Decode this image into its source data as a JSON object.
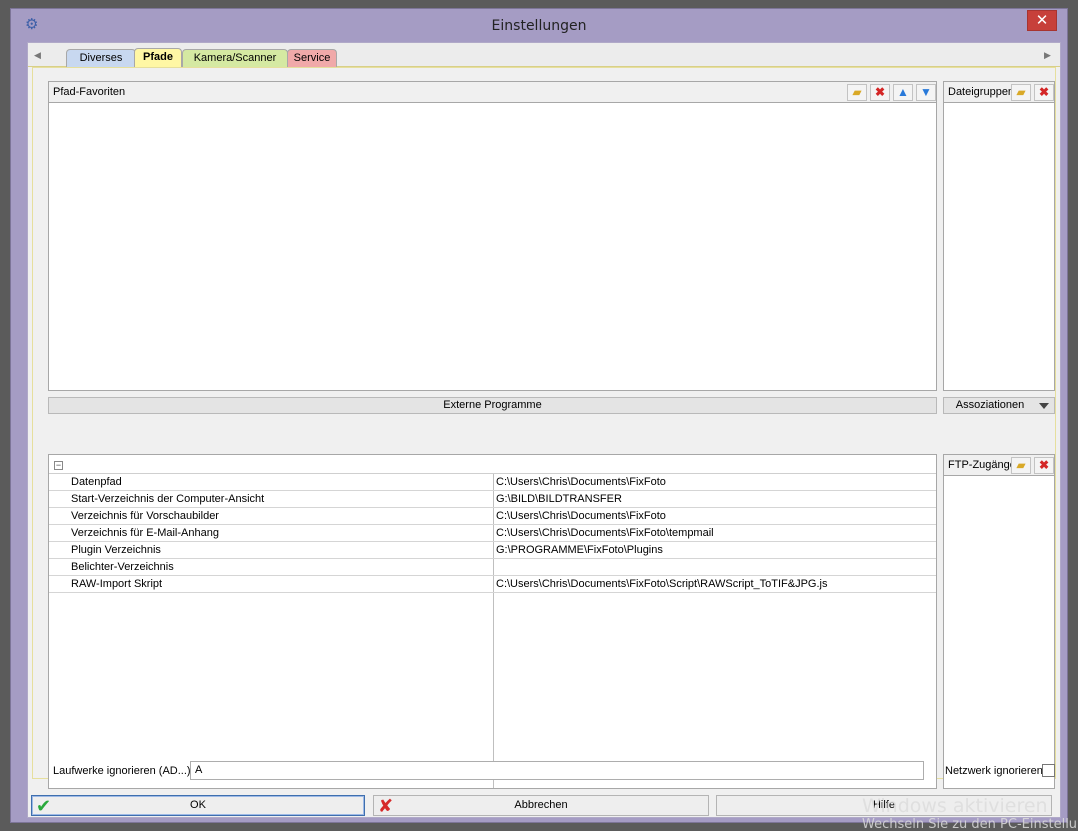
{
  "window": {
    "title": "Einstellungen",
    "close_label": "✕",
    "app_icon": "gear-icon"
  },
  "tabs": [
    {
      "label": "Diverses",
      "active": false
    },
    {
      "label": "Pfade",
      "active": true
    },
    {
      "label": "Kamera/Scanner",
      "active": false
    },
    {
      "label": "Service",
      "active": false
    }
  ],
  "favorites": {
    "title": "Pfad-Favoriten",
    "buttons": [
      "new-folder-icon",
      "delete-icon",
      "move-up-icon",
      "move-down-icon"
    ]
  },
  "file_groups": {
    "title": "Dateigruppen",
    "buttons": [
      "new-folder-icon",
      "delete-icon"
    ]
  },
  "external_programs": {
    "label": "Externe Programme"
  },
  "associations": {
    "label": "Assoziationen"
  },
  "paths": {
    "rows": [
      {
        "name": "Datenpfad",
        "value": "C:\\Users\\Chris\\Documents\\FixFoto"
      },
      {
        "name": "Start-Verzeichnis der Computer-Ansicht",
        "value": "G:\\BILD\\BILDTRANSFER"
      },
      {
        "name": "Verzeichnis für Vorschaubilder",
        "value": "C:\\Users\\Chris\\Documents\\FixFoto"
      },
      {
        "name": "Verzeichnis für E-Mail-Anhang",
        "value": "C:\\Users\\Chris\\Documents\\FixFoto\\tempmail"
      },
      {
        "name": "Plugin Verzeichnis",
        "value": "G:\\PROGRAMME\\FixFoto\\Plugins"
      },
      {
        "name": "Belichter-Verzeichnis",
        "value": ""
      },
      {
        "name": "RAW-Import Skript",
        "value": "C:\\Users\\Chris\\Documents\\FixFoto\\Script\\RAWScript_ToTIF&JPG.js"
      }
    ]
  },
  "ftp": {
    "title": "FTP-Zugänge",
    "buttons": [
      "new-folder-icon",
      "delete-icon"
    ]
  },
  "drives": {
    "label": "Laufwerke ignorieren (AD...)",
    "value": "A"
  },
  "network": {
    "label": "Netzwerk ignorieren",
    "checked": false
  },
  "actions": {
    "ok": "OK",
    "cancel": "Abbrechen",
    "help": "Hilfe"
  },
  "watermark": {
    "line1": "Windows aktivieren",
    "line2": "Wechseln Sie zu den PC-Einstellu"
  }
}
